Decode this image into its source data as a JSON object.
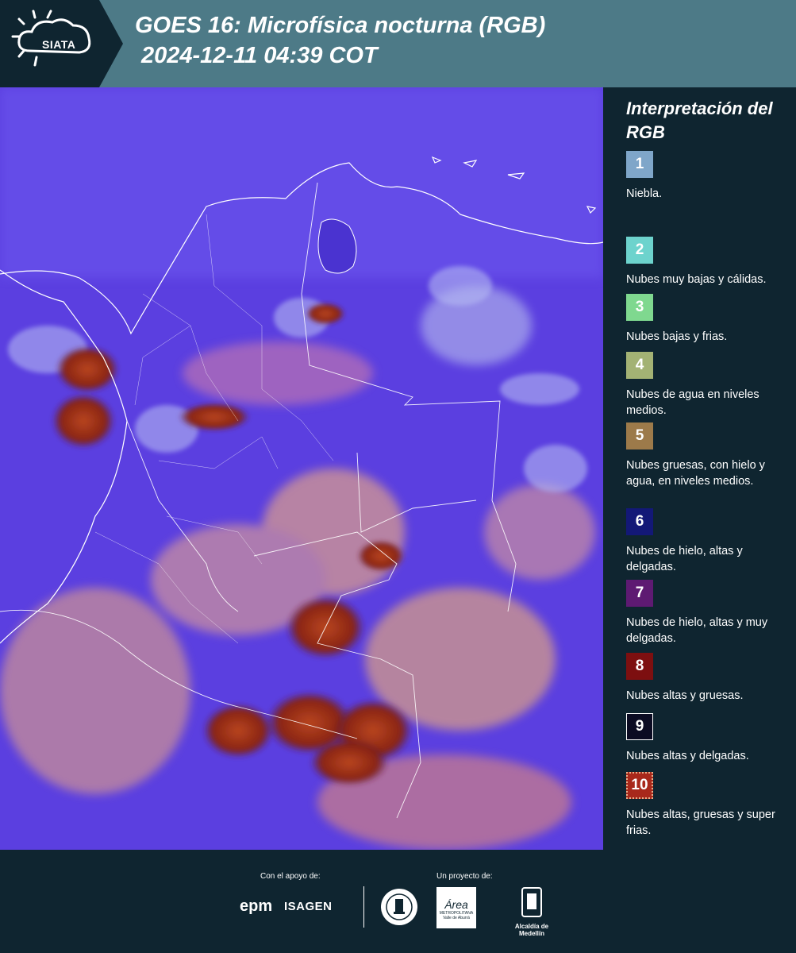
{
  "header": {
    "brand": "SIATA",
    "title_line1": "GOES 16: Microfísica nocturna (RGB)",
    "title_line2": "2024-12-11 04:39 COT"
  },
  "legend": {
    "title": "Interpretación del RGB",
    "items": [
      {
        "number": "1",
        "label": "Niebla.",
        "color": "#7fa6c9"
      },
      {
        "number": "2",
        "label": "Nubes muy bajas y cálidas.",
        "color": "#6dd3cd"
      },
      {
        "number": "3",
        "label": "Nubes bajas y frias.",
        "color": "#7fd88f"
      },
      {
        "number": "4",
        "label": "Nubes de agua en niveles medios.",
        "color": "#a3b274"
      },
      {
        "number": "5",
        "label": "Nubes gruesas, con hielo y agua, en niveles medios.",
        "color": "#9c7a4a"
      },
      {
        "number": "6",
        "label": "Nubes de hielo, altas y delgadas.",
        "color": "#131877"
      },
      {
        "number": "7",
        "label": "Nubes de hielo, altas y muy delgadas.",
        "color": "#5e1a72"
      },
      {
        "number": "8",
        "label": "Nubes altas y gruesas.",
        "color": "#7d0f10"
      },
      {
        "number": "9",
        "label": "Nubes altas y delgadas.",
        "color": "#0b0b22"
      },
      {
        "number": "10",
        "label": "Nubes altas, gruesas y super frias.",
        "color": "#a8281b"
      }
    ]
  },
  "footer": {
    "support_caption": "Con el apoyo de:",
    "project_caption": "Un proyecto de:",
    "epm": "epm",
    "isagen": "ISAGEN",
    "area": "Área",
    "area_sub": "METROPOLITANA Valle de Aburrá",
    "medellin": "Alcaldía de Medellín"
  },
  "colors": {
    "header_bg": "#4d7a87",
    "panel_bg": "#0f2530",
    "map_base": "#5b3fe0"
  }
}
